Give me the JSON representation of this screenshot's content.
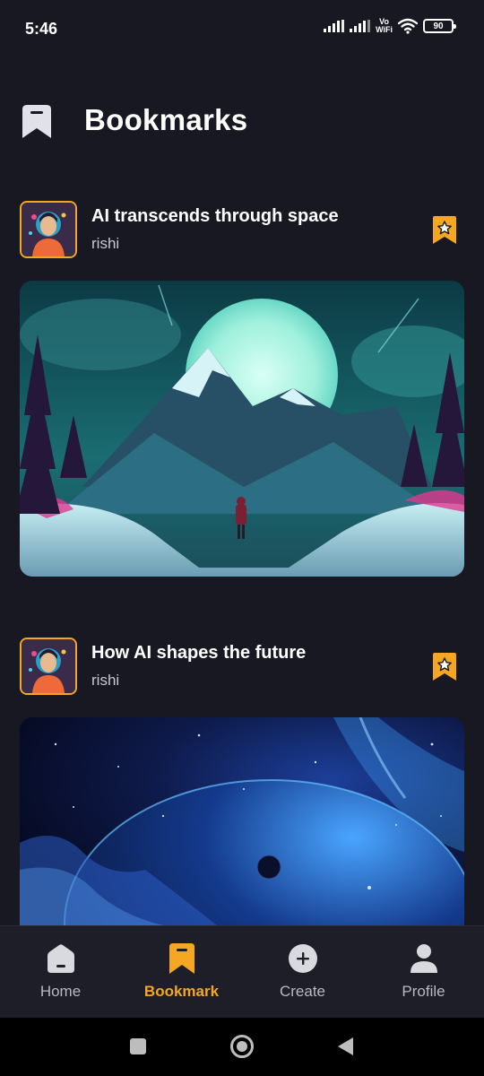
{
  "status_bar": {
    "time": "5:46",
    "vo_label": "Vo",
    "wifi_label": "WiFi",
    "battery": "90"
  },
  "header": {
    "title": "Bookmarks",
    "icon": "bookmark-icon"
  },
  "posts": [
    {
      "title": "AI transcends through space",
      "author": "rishi",
      "bookmarked": true,
      "image": "moonlit-mountain-landscape"
    },
    {
      "title": "How AI shapes the future",
      "author": "rishi",
      "bookmarked": true,
      "image": "cosmic-planet-nebula"
    }
  ],
  "bottom_nav": {
    "items": [
      {
        "label": "Home",
        "icon": "home-icon",
        "active": false
      },
      {
        "label": "Bookmark",
        "icon": "bookmark-icon",
        "active": true
      },
      {
        "label": "Create",
        "icon": "plus-circle-icon",
        "active": false
      },
      {
        "label": "Profile",
        "icon": "person-icon",
        "active": false
      }
    ]
  },
  "colors": {
    "background": "#171821",
    "accent": "#f5a623",
    "nav_background": "#1d1e28",
    "muted_text": "#b8b8c2"
  }
}
